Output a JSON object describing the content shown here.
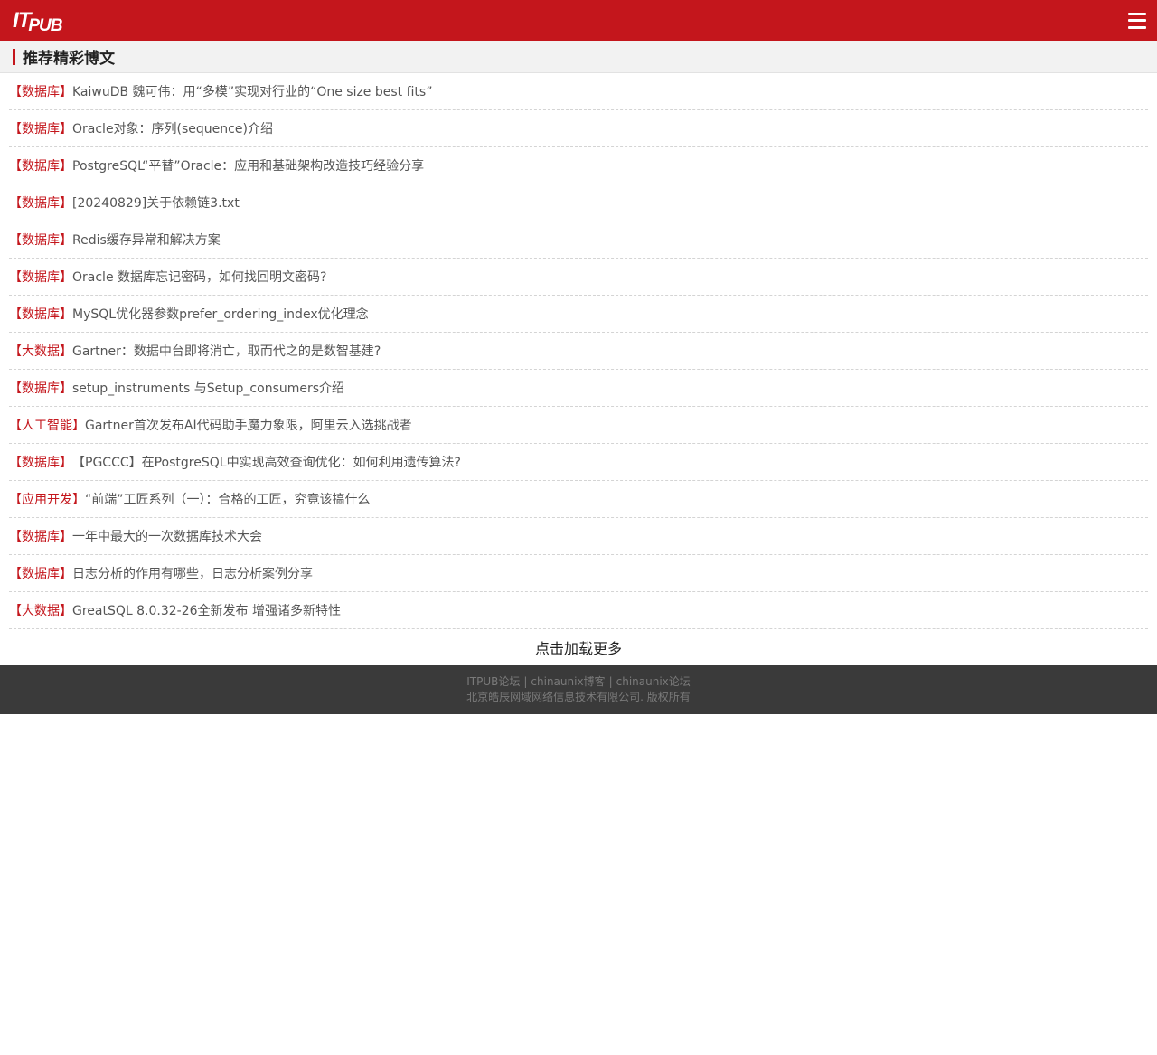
{
  "header": {
    "logo_it": "IT",
    "logo_pub": "PUB",
    "brand_color": "#c4161c"
  },
  "section": {
    "title": "推荐精彩博文"
  },
  "articles": [
    {
      "category": "【数据库】",
      "title": "KaiwuDB 魏可伟：用“多模”实现对行业的“One size best fits”"
    },
    {
      "category": "【数据库】",
      "title": "Oracle对象：序列(sequence)介绍"
    },
    {
      "category": "【数据库】",
      "title": "PostgreSQL“平替”Oracle：应用和基础架构改造技巧经验分享"
    },
    {
      "category": "【数据库】",
      "title": "[20240829]关于依赖链3.txt"
    },
    {
      "category": "【数据库】",
      "title": "Redis缓存异常和解决方案"
    },
    {
      "category": "【数据库】",
      "title": "Oracle 数据库忘记密码，如何找回明文密码?"
    },
    {
      "category": "【数据库】",
      "title": "MySQL优化器参数prefer_ordering_index优化理念"
    },
    {
      "category": "【大数据】",
      "title": "Gartner：数据中台即将消亡，取而代之的是数智基建?"
    },
    {
      "category": "【数据库】",
      "title": "setup_instruments 与Setup_consumers介绍"
    },
    {
      "category": "【人工智能】",
      "title": "Gartner首次发布AI代码助手魔力象限，阿里云入选挑战者"
    },
    {
      "category": "【数据库】",
      "title": "【PGCCC】在PostgreSQL中实现高效查询优化：如何利用遗传算法?"
    },
    {
      "category": "【应用开发】",
      "title": "“前端”工匠系列（一）：合格的工匠，究竟该搞什么"
    },
    {
      "category": "【数据库】",
      "title": "一年中最大的一次数据库技术大会"
    },
    {
      "category": "【数据库】",
      "title": "日志分析的作用有哪些，日志分析案例分享"
    },
    {
      "category": "【大数据】",
      "title": "GreatSQL 8.0.32-26全新发布 增强诸多新特性"
    }
  ],
  "load_more": "点击加载更多",
  "footer": {
    "links": [
      "ITPUB论坛",
      "chinaunix博客",
      "chinaunix论坛"
    ],
    "separator": "|",
    "copyright": "北京皓辰网域网络信息技术有限公司. 版权所有"
  }
}
